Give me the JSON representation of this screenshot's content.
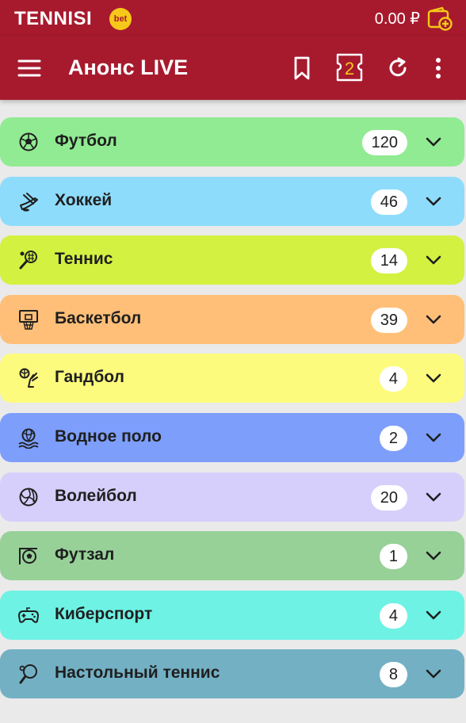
{
  "status_bar": {
    "brand": "TENNISI",
    "brand_badge": "bet",
    "balance": "0.00 ₽"
  },
  "header": {
    "title": "Анонс LIVE",
    "coupon_count": "2"
  },
  "colors": {
    "brand": "#a71a2e",
    "accent_yellow": "#f6c81a",
    "background": "#eaeaea"
  },
  "sports": [
    {
      "name": "Футбол",
      "count": "120",
      "color": "#91eb92",
      "icon": "soccer-ball-icon"
    },
    {
      "name": "Хоккей",
      "count": "46",
      "color": "#8edcfc",
      "icon": "hockey-icon"
    },
    {
      "name": "Теннис",
      "count": "14",
      "color": "#d3f140",
      "icon": "tennis-racket-icon"
    },
    {
      "name": "Баскетбол",
      "count": "39",
      "color": "#ffbf78",
      "icon": "basketball-hoop-icon"
    },
    {
      "name": "Гандбол",
      "count": "4",
      "color": "#fdfb7d",
      "icon": "handball-icon"
    },
    {
      "name": "Водное поло",
      "count": "2",
      "color": "#7d9efb",
      "icon": "water-polo-icon"
    },
    {
      "name": "Волейбол",
      "count": "20",
      "color": "#d6cffb",
      "icon": "volleyball-icon"
    },
    {
      "name": "Футзал",
      "count": "1",
      "color": "#97d198",
      "icon": "futsal-icon"
    },
    {
      "name": "Киберспорт",
      "count": "4",
      "color": "#6ef2e4",
      "icon": "gamepad-icon"
    },
    {
      "name": "Настольный теннис",
      "count": "8",
      "color": "#73b0c4",
      "icon": "table-tennis-icon"
    }
  ]
}
